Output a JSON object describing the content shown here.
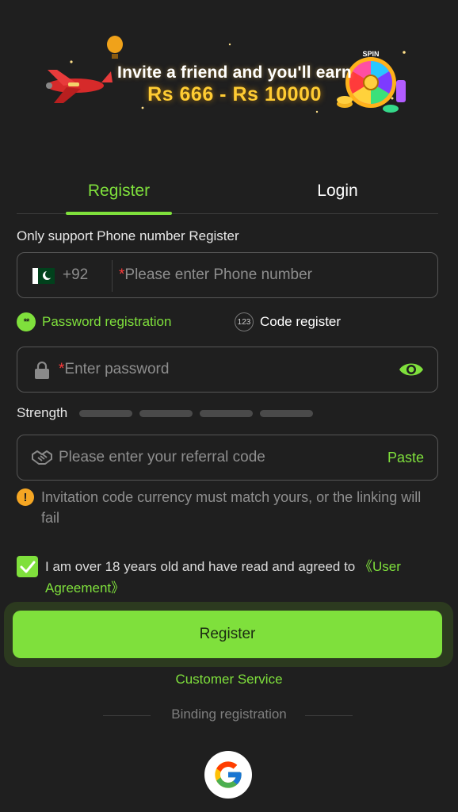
{
  "banner": {
    "line1": "Invite a friend and you'll earn",
    "line2": "Rs 666 - Rs 10000",
    "wheel_label": "SPIN"
  },
  "tabs": [
    {
      "label": "Register",
      "active": true
    },
    {
      "label": "Login",
      "active": false
    }
  ],
  "hint": "Only support Phone number Register",
  "phone": {
    "country_code": "+92",
    "required_mark": "*",
    "placeholder": "Please enter Phone number"
  },
  "reg_options": {
    "password": {
      "icon_text": "**",
      "label": "Password registration",
      "selected": true
    },
    "code": {
      "icon_text": "123",
      "label": "Code register",
      "selected": false
    }
  },
  "password": {
    "required_mark": "*",
    "placeholder": "Enter password"
  },
  "strength": {
    "label": "Strength",
    "level": 0,
    "segments": 4
  },
  "referral": {
    "placeholder": "Please enter your referral code",
    "paste_label": "Paste"
  },
  "warning": {
    "icon_text": "!",
    "text": "Invitation code currency must match yours, or the linking will fail"
  },
  "agreement": {
    "checked": true,
    "text": "I am over 18 years old and have read and agreed to ",
    "link": "《User Agreement》"
  },
  "register_button": "Register",
  "customer_service": "Customer Service",
  "binding_label": "Binding registration",
  "colors": {
    "accent": "#7fe03c",
    "background": "#1f1f1f",
    "border": "#565656",
    "warning": "#f5a623",
    "required": "#ff3b3b"
  },
  "icons": [
    "pakistan-flag-icon",
    "lock-icon",
    "eye-icon",
    "handshake-icon",
    "warning-icon",
    "check-icon",
    "google-icon"
  ]
}
